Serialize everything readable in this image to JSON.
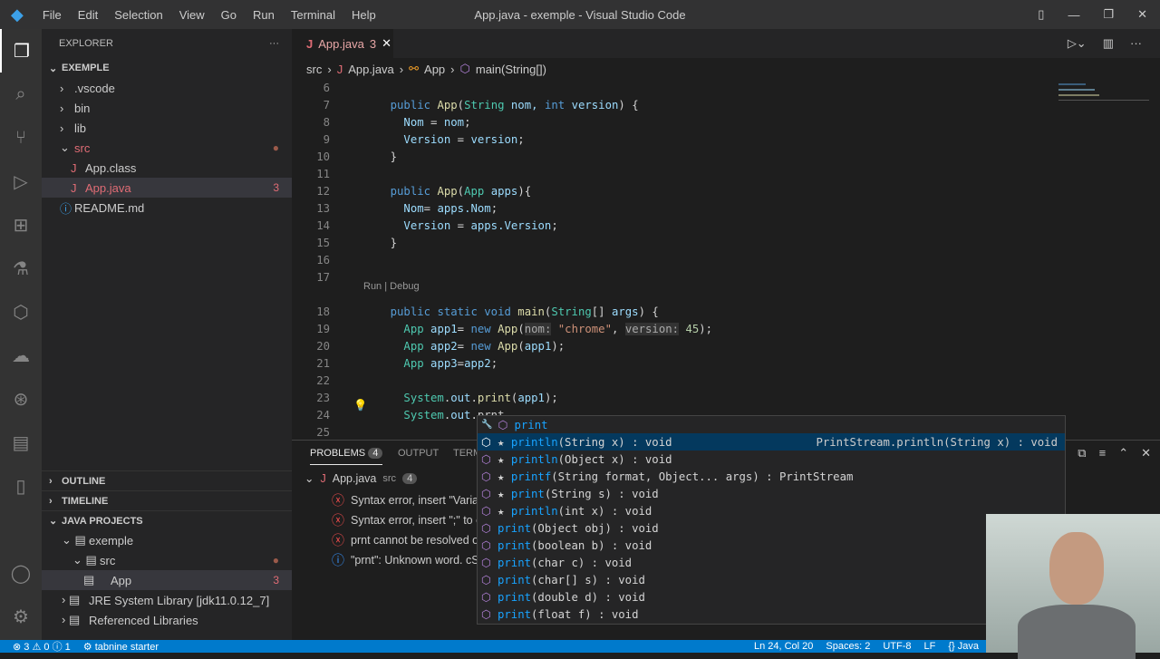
{
  "titlebar": {
    "menu": [
      "File",
      "Edit",
      "Selection",
      "View",
      "Go",
      "Run",
      "Terminal",
      "Help"
    ],
    "title": "App.java - exemple - Visual Studio Code"
  },
  "sidebar": {
    "header": "EXPLORER",
    "project": "EXEMPLE",
    "tree": [
      {
        "label": ".vscode",
        "indent": 1,
        "icon": "chevron-right",
        "badge": ""
      },
      {
        "label": "bin",
        "indent": 1,
        "icon": "chevron-right",
        "badge": ""
      },
      {
        "label": "lib",
        "indent": 1,
        "icon": "chevron-right",
        "badge": ""
      },
      {
        "label": "src",
        "indent": 1,
        "icon": "chevron-down",
        "badge": "●"
      },
      {
        "label": "App.class",
        "indent": 2,
        "icon": "java",
        "badge": ""
      },
      {
        "label": "App.java",
        "indent": 2,
        "icon": "java",
        "badge": "3"
      },
      {
        "label": "README.md",
        "indent": 1,
        "icon": "info",
        "badge": ""
      }
    ],
    "outline": "OUTLINE",
    "timeline": "TIMELINE",
    "java_projects": "JAVA PROJECTS",
    "jp_tree": [
      {
        "label": "exemple",
        "indent": 1,
        "badge": ""
      },
      {
        "label": "src",
        "indent": 2,
        "badge": "●"
      },
      {
        "label": "App",
        "indent": 3,
        "badge": "3"
      },
      {
        "label": "JRE System Library [jdk11.0.12_7]",
        "indent": 1,
        "badge": ""
      },
      {
        "label": "Referenced Libraries",
        "indent": 1,
        "badge": ""
      }
    ]
  },
  "tab": {
    "label": "App.java",
    "count": "3"
  },
  "breadcrumb": [
    "src",
    "App.java",
    "App",
    "main(String[])"
  ],
  "editor": {
    "codelens": "Run | Debug",
    "lines": [
      {
        "n": "6",
        "t": []
      },
      {
        "n": "7",
        "t": [
          [
            "    ",
            "pl"
          ],
          [
            "public ",
            "kw"
          ],
          [
            "App",
            "fn"
          ],
          [
            "(",
            "pl"
          ],
          [
            "String ",
            "ty"
          ],
          [
            "nom, ",
            "va"
          ],
          [
            "int ",
            "kw"
          ],
          [
            "version",
            "va"
          ],
          [
            ") {",
            "pl"
          ]
        ]
      },
      {
        "n": "8",
        "t": [
          [
            "      Nom ",
            "va"
          ],
          [
            "= ",
            "pl"
          ],
          [
            "nom",
            "va"
          ],
          [
            ";",
            "pl"
          ]
        ]
      },
      {
        "n": "9",
        "t": [
          [
            "      Version ",
            "va"
          ],
          [
            "= ",
            "pl"
          ],
          [
            "version",
            "va"
          ],
          [
            ";",
            "pl"
          ]
        ]
      },
      {
        "n": "10",
        "t": [
          [
            "    }",
            "pl"
          ]
        ]
      },
      {
        "n": "11",
        "t": []
      },
      {
        "n": "12",
        "t": [
          [
            "    ",
            "pl"
          ],
          [
            "public ",
            "kw"
          ],
          [
            "App",
            "fn"
          ],
          [
            "(",
            "pl"
          ],
          [
            "App ",
            "ty"
          ],
          [
            "apps",
            "va"
          ],
          [
            "){",
            "pl"
          ]
        ]
      },
      {
        "n": "13",
        "t": [
          [
            "      Nom",
            "va"
          ],
          [
            "= ",
            "pl"
          ],
          [
            "apps.Nom",
            "va"
          ],
          [
            ";",
            "pl"
          ]
        ]
      },
      {
        "n": "14",
        "t": [
          [
            "      Version ",
            "va"
          ],
          [
            "= ",
            "pl"
          ],
          [
            "apps.Version",
            "va"
          ],
          [
            ";",
            "pl"
          ]
        ]
      },
      {
        "n": "15",
        "t": [
          [
            "    }",
            "pl"
          ]
        ]
      },
      {
        "n": "16",
        "t": []
      },
      {
        "n": "17",
        "t": []
      },
      {
        "n": "18",
        "t": [
          [
            "    ",
            "pl"
          ],
          [
            "public static void ",
            "kw"
          ],
          [
            "main",
            "fn"
          ],
          [
            "(",
            "pl"
          ],
          [
            "String",
            "ty"
          ],
          [
            "[] ",
            "pl"
          ],
          [
            "args",
            "va"
          ],
          [
            ") {",
            "pl"
          ]
        ]
      },
      {
        "n": "19",
        "t": [
          [
            "      App ",
            "ty"
          ],
          [
            "app1",
            "va"
          ],
          [
            "= ",
            "pl"
          ],
          [
            "new ",
            "kw"
          ],
          [
            "App",
            "fn"
          ],
          [
            "(",
            "pl"
          ],
          [
            "nom:",
            "hint"
          ],
          [
            " ",
            "pl"
          ],
          [
            "\"chrome\"",
            "st"
          ],
          [
            ", ",
            "pl"
          ],
          [
            "version:",
            "hint"
          ],
          [
            " ",
            "pl"
          ],
          [
            "45",
            "nu"
          ],
          [
            ");",
            "pl"
          ]
        ]
      },
      {
        "n": "20",
        "t": [
          [
            "      App ",
            "ty"
          ],
          [
            "app2",
            "va"
          ],
          [
            "= ",
            "pl"
          ],
          [
            "new ",
            "kw"
          ],
          [
            "App",
            "fn"
          ],
          [
            "(",
            "pl"
          ],
          [
            "app1",
            "va"
          ],
          [
            ");",
            "pl"
          ]
        ]
      },
      {
        "n": "21",
        "t": [
          [
            "      App ",
            "ty"
          ],
          [
            "app3",
            "va"
          ],
          [
            "=",
            "pl"
          ],
          [
            "app2",
            "va"
          ],
          [
            ";",
            "pl"
          ]
        ]
      },
      {
        "n": "22",
        "t": []
      },
      {
        "n": "23",
        "t": [
          [
            "      System",
            "ty"
          ],
          [
            ".",
            "pl"
          ],
          [
            "out",
            "va"
          ],
          [
            ".",
            "pl"
          ],
          [
            "print",
            "fn"
          ],
          [
            "(",
            "pl"
          ],
          [
            "app1",
            "va"
          ],
          [
            ");",
            "pl"
          ]
        ]
      },
      {
        "n": "24",
        "t": [
          [
            "      System",
            "ty"
          ],
          [
            ".",
            "pl"
          ],
          [
            "out",
            "va"
          ],
          [
            ".",
            "pl"
          ],
          [
            "prnt",
            "err"
          ]
        ]
      },
      {
        "n": "25",
        "t": []
      }
    ]
  },
  "panel": {
    "tabs": [
      "PROBLEMS",
      "OUTPUT",
      "TERMINAL"
    ],
    "problem_count": "4",
    "file": "App.java",
    "file_dir": "src",
    "file_count": "4",
    "problems": [
      {
        "type": "error",
        "text": "Syntax error, insert \"Variab"
      },
      {
        "type": "error",
        "text": "Syntax error, insert \";\" to c"
      },
      {
        "type": "error",
        "text": "prnt cannot be resolved o"
      },
      {
        "type": "info",
        "text": "\"prnt\": Unknown word.  cS"
      }
    ]
  },
  "suggest": {
    "items": [
      {
        "star": false,
        "label": "print",
        "sig": "",
        "kind": "snippet",
        "detail": ""
      },
      {
        "star": true,
        "label": "println",
        "sig": "(String x) : void",
        "detail": "PrintStream.println(String x) : void"
      },
      {
        "star": true,
        "label": "println",
        "sig": "(Object x) : void",
        "detail": ""
      },
      {
        "star": true,
        "label": "printf",
        "sig": "(String format, Object... args) : PrintStream",
        "detail": ""
      },
      {
        "star": true,
        "label": "print",
        "sig": "(String s) : void",
        "detail": ""
      },
      {
        "star": true,
        "label": "println",
        "sig": "(int x) : void",
        "detail": ""
      },
      {
        "star": false,
        "label": "print",
        "sig": "(Object obj) : void",
        "detail": ""
      },
      {
        "star": false,
        "label": "print",
        "sig": "(boolean b) : void",
        "detail": ""
      },
      {
        "star": false,
        "label": "print",
        "sig": "(char c) : void",
        "detail": ""
      },
      {
        "star": false,
        "label": "print",
        "sig": "(char[] s) : void",
        "detail": ""
      },
      {
        "star": false,
        "label": "print",
        "sig": "(double d) : void",
        "detail": ""
      },
      {
        "star": false,
        "label": "print",
        "sig": "(float f) : void",
        "detail": ""
      }
    ]
  },
  "status": {
    "errors": "3",
    "warnings": "0",
    "infos": "1",
    "tabnine": "tabnine starter",
    "position": "Ln 24, Col 20",
    "spaces": "Spaces: 2",
    "encoding": "UTF-8",
    "eol": "LF",
    "language": "Java"
  }
}
